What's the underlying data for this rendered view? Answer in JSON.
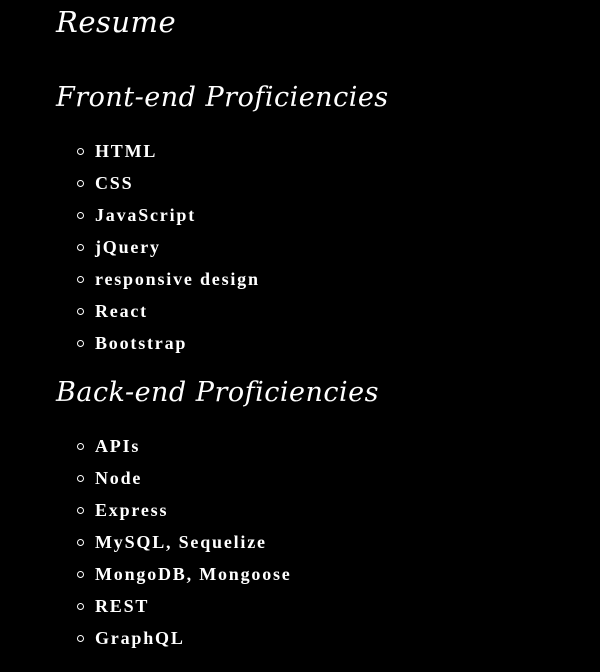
{
  "page": {
    "title": "Resume"
  },
  "frontend": {
    "heading": "Front-end Proficiencies",
    "items": [
      "HTML",
      "CSS",
      "JavaScript",
      "jQuery",
      "responsive design",
      "React",
      "Bootstrap"
    ]
  },
  "backend": {
    "heading": "Back-end Proficiencies",
    "items": [
      "APIs",
      "Node",
      "Express",
      "MySQL, Sequelize",
      "MongoDB, Mongoose",
      "REST",
      "GraphQL"
    ]
  },
  "colors": {
    "background": "#000000",
    "text": "#ffffff"
  }
}
